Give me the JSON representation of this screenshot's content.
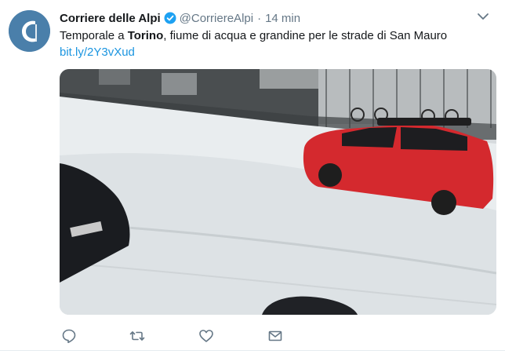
{
  "tweet": {
    "author_name": "Corriere delle Alpi",
    "author_handle": "@CorriereAlpi",
    "separator": "·",
    "timestamp": "14 min",
    "text_before": "Temporale a ",
    "text_bold": "Torino",
    "text_after": ", fiume di acqua e grandine per le strade di San Mauro",
    "link": "bit.ly/2Y3vXud"
  },
  "icons": {
    "avatar": "corriere-alpi-logo",
    "verified": "verified-badge-icon",
    "caret": "chevron-down-icon",
    "reply": "reply-icon",
    "retweet": "retweet-icon",
    "like": "heart-icon",
    "dm": "envelope-icon"
  },
  "colors": {
    "link": "#1b95e0",
    "verified": "#1da1f2",
    "meta": "#657786",
    "icon": "#657786"
  }
}
